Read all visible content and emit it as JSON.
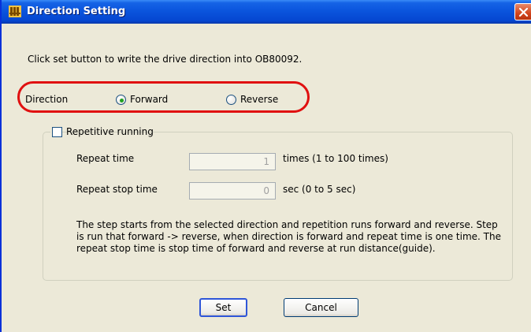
{
  "window": {
    "title": "Direction Setting",
    "instruction": "Click set button to write the drive direction into OB80092."
  },
  "direction": {
    "label": "Direction",
    "options": [
      "Forward",
      "Reverse"
    ],
    "selected": "Forward",
    "highlight_color": "#e01010"
  },
  "repetitive": {
    "label": "Repetitive running",
    "checked": false,
    "repeat_time": {
      "label": "Repeat time",
      "value": "1",
      "unit": "times (1 to 100 times)"
    },
    "repeat_stop_time": {
      "label": "Repeat stop time",
      "value": "0",
      "unit": "sec (0 to 5 sec)"
    },
    "help_text": "The step starts from the selected direction and repetition runs forward and reverse. Step is run that forward -> reverse, when direction is forward and repeat time is one time. The repeat stop time is stop time of forward and reverse at run distance(guide)."
  },
  "buttons": {
    "set": "Set",
    "cancel": "Cancel"
  },
  "icons": {
    "app": "app-window-icon",
    "close": "close-icon"
  },
  "colors": {
    "title_bar": "#0a53dc",
    "dialog_bg": "#ece9d8",
    "close_button": "#d2441c"
  }
}
